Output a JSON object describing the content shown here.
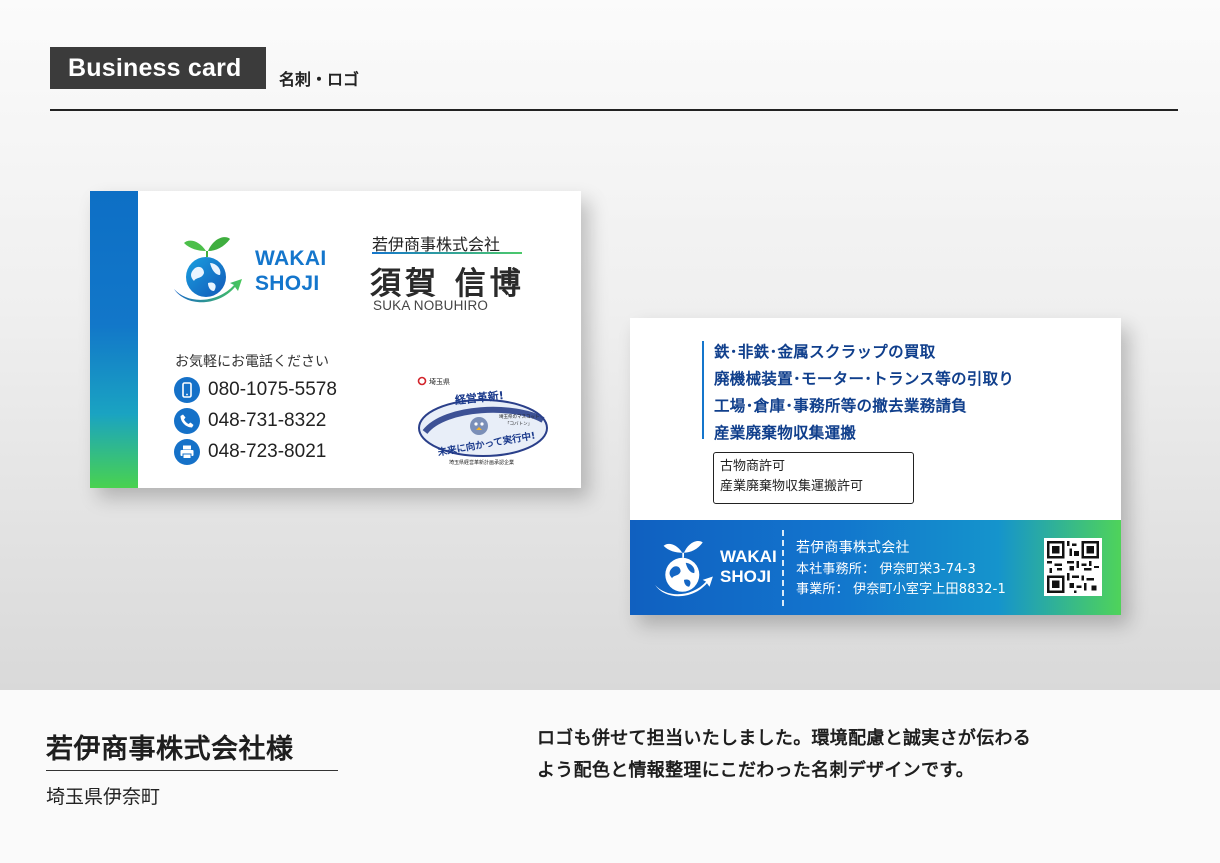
{
  "header": {
    "tag": "Business card",
    "subtitle": "名刺・ロゴ"
  },
  "front_card": {
    "logo_lines": [
      "WAKAI",
      "SHOJI"
    ],
    "company": "若伊商事株式会社",
    "name": "須賀 信博",
    "name_roman": "SUKA NOBUHIRO",
    "call_label": "お気軽にお電話ください",
    "contacts": [
      {
        "icon": "mobile-phone-icon",
        "number": "080-1075-5578"
      },
      {
        "icon": "phone-icon",
        "number": "048-731-8322"
      },
      {
        "icon": "fax-icon",
        "number": "048-723-8021"
      }
    ],
    "badge": {
      "prefecture": "埼玉県",
      "headline": "経営革新!",
      "mascot_note_1": "埼玉県のマスコット",
      "mascot_note_2": "「コバトン」",
      "slogan": "未来に向かって実行中!",
      "footer": "埼玉県経営革新計画承認企業"
    }
  },
  "back_card": {
    "services": [
      "鉄･非鉄･金属スクラップの買取",
      "廃機械装置･モーター･トランス等の引取り",
      "工場･倉庫･事務所等の撤去業務請負",
      "産業廃棄物収集運搬"
    ],
    "licenses": [
      "古物商許可",
      "産業廃棄物収集運搬許可"
    ],
    "logo_lines": [
      "WAKAI",
      "SHOJI"
    ],
    "company": "若伊商事株式会社",
    "head_office": "本社事務所： 伊奈町栄3-74-3",
    "office": "事業所： 伊奈町小室字上田8832-1"
  },
  "footer": {
    "client": "若伊商事株式会社様",
    "location": "埼玉県伊奈町",
    "description_line1": "ロゴも併せて担当いたしました。環境配慮と誠実さが伝わる",
    "description_line2": "よう配色と情報整理にこだわった名刺デザインです。"
  },
  "colors": {
    "brand_blue": "#1476cc",
    "brand_green": "#4cc96a",
    "navy_text": "#103f8c",
    "header_tag_bg": "#3b3b3b"
  }
}
